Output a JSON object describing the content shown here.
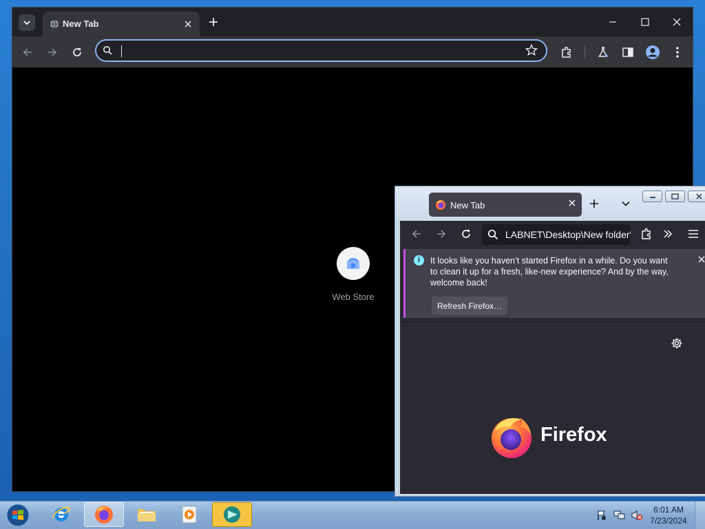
{
  "chrome": {
    "tab_title": "New Tab",
    "omnibox_value": "",
    "shortcuts": [
      {
        "label": "Web Store"
      }
    ]
  },
  "firefox": {
    "tab_title": "New Tab",
    "url_text": "LABNET\\Desktop\\New folder\"",
    "notification": {
      "message": "It looks like you haven’t started Firefox in a while. Do you want to clean it up for a fresh, like-new experience? And by the way, welcome back!",
      "button_label": "Refresh Firefox…"
    },
    "wordmark": "Firefox"
  },
  "taskbar": {
    "items": [
      "internet-explorer",
      "firefox",
      "file-explorer",
      "media-player",
      "app"
    ],
    "clock": {
      "time": "6:01 AM",
      "date": "7/23/2024"
    }
  },
  "colors": {
    "chrome_accent": "#8ab4f8",
    "firefox_notification_accent": "#c850e6",
    "taskbar_highlight": "#f5c542"
  }
}
